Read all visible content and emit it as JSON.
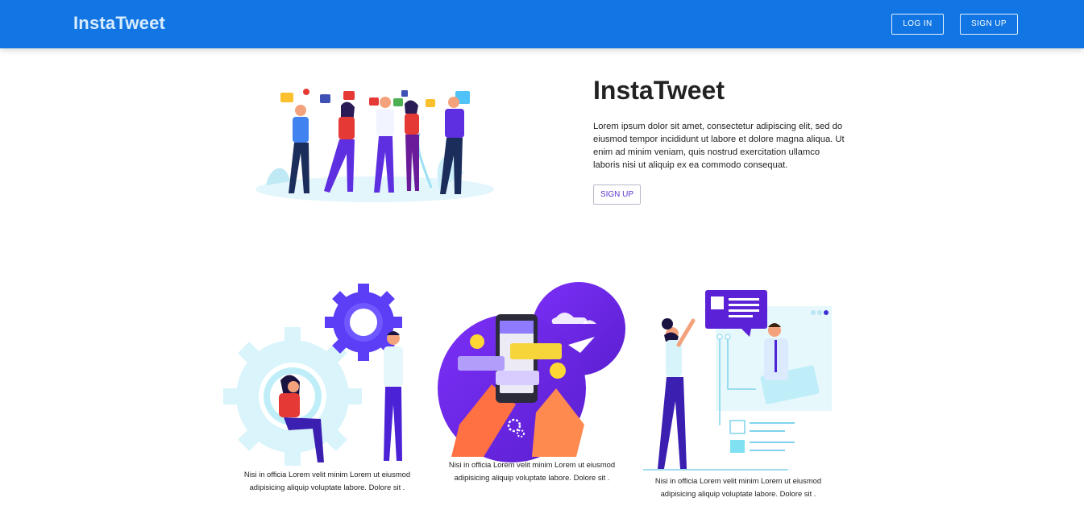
{
  "header": {
    "brand": "InstaTweet",
    "login_label": "LOG IN",
    "signup_label": "SIGN UP"
  },
  "hero": {
    "title": "InstaTweet",
    "text": "Lorem ipsum dolor sit amet, consectetur adipiscing elit, sed do eiusmod tempor incididunt ut labore et dolore magna aliqua. Ut enim ad minim veniam, quis nostrud exercitation ullamco laboris nisi ut aliquip ex ea commodo consequat.",
    "signup_label": "SIGN UP"
  },
  "features": [
    {
      "caption": "Nisi in officia Lorem velit minim Lorem ut eiusmod adipisicing aliquip voluptate labore. Dolore sit ."
    },
    {
      "caption": "Nisi in officia Lorem velit minim Lorem ut eiusmod adipisicing aliquip voluptate labore. Dolore sit ."
    },
    {
      "caption": "Nisi in officia Lorem velit minim Lorem ut eiusmod adipisicing aliquip voluptate labore. Dolore sit ."
    }
  ],
  "colors": {
    "navbar": "#1176e3",
    "accent_purple": "#5a35cc",
    "violet": "#7b2ff7"
  }
}
